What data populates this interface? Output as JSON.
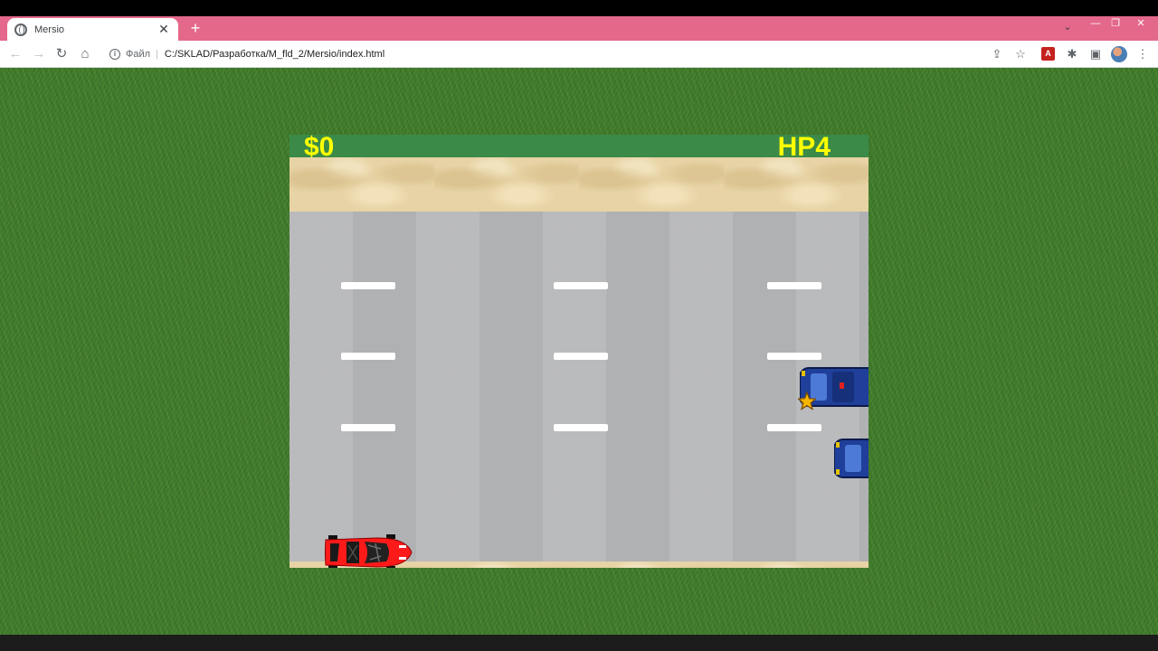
{
  "browser": {
    "tab_title": "Mersio",
    "tab_close": "✕",
    "new_tab": "+",
    "tab_search": "⌄",
    "window_min": "—",
    "window_max": "❐",
    "window_close": "✕",
    "nav_back": "←",
    "nav_forward": "→",
    "nav_reload": "↻",
    "nav_home": "⌂",
    "omnibox_scheme_label": "Файл",
    "omnibox_separator": "|",
    "omnibox_url": "C:/SKLAD/Разработка/M_fld_2/Mersio/index.html",
    "info_icon": "i",
    "share_icon": "⇪",
    "star_icon": "☆",
    "pdf_icon": "A",
    "extensions_icon": "✱",
    "sidepanel_icon": "▣",
    "menu_icon": "⋮"
  },
  "game": {
    "money": "$0",
    "hp": "HP4",
    "player_car_color": "#ff1a1a",
    "enemy_car_color": "#1f3f9a",
    "pickup": "star",
    "pickup_color": "#f5b400"
  },
  "colors": {
    "tab_strip": "#e4688a",
    "hud_text": "#ffff00",
    "grass": "#3f7a2a",
    "road": "#b6b7b9",
    "sand": "#e7d3a5",
    "game_border": "#3b8a48"
  }
}
